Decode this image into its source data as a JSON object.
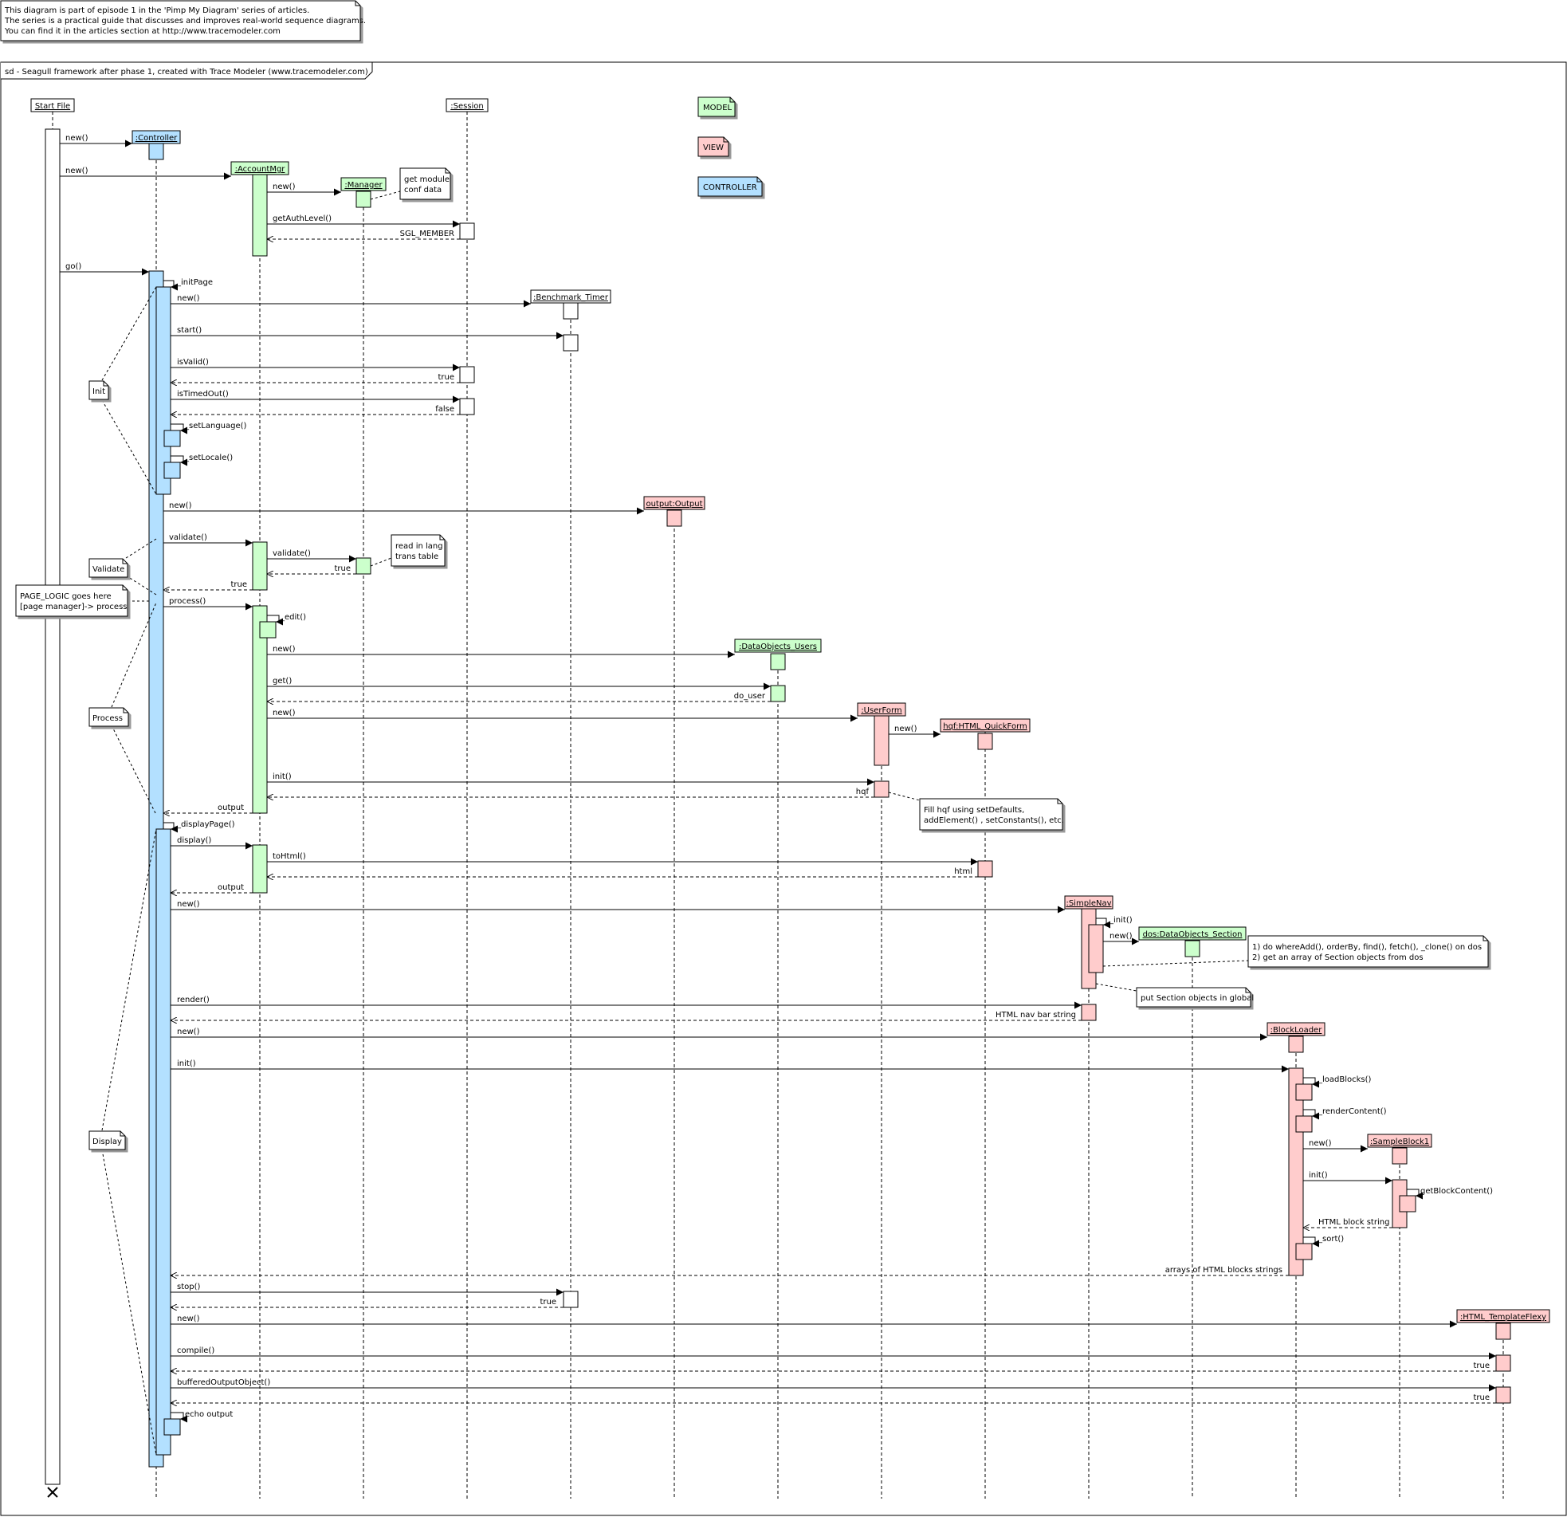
{
  "header_note": {
    "lines": [
      "This diagram is part of episode 1 in the 'Pimp My Diagram' series of articles.",
      "The series is a practical guide that discusses and improves real-world sequence diagrams.",
      "You can find it in the articles section at http://www.tracemodeler.com"
    ]
  },
  "frame": {
    "title": "sd - Seagull framework after phase 1, created with Trace Modeler (www.tracemodeler.com)"
  },
  "colors": {
    "model": "#ccffcc",
    "view": "#ffcccc",
    "controller": "#b3e0ff",
    "plain": "#ffffff",
    "line": "#000000"
  },
  "legend": {
    "model": "MODEL",
    "view": "VIEW",
    "controller": "CONTROLLER"
  },
  "lifelines": [
    {
      "id": "start",
      "label": "Start File",
      "kind": "plain"
    },
    {
      "id": "controller",
      "label": ":Controller",
      "kind": "controller"
    },
    {
      "id": "accountmgr",
      "label": ":AccountMgr",
      "kind": "model"
    },
    {
      "id": "manager",
      "label": ":Manager",
      "kind": "model"
    },
    {
      "id": "session",
      "label": ":Session",
      "kind": "plain"
    },
    {
      "id": "timer",
      "label": ":Benchmark_Timer",
      "kind": "plain"
    },
    {
      "id": "output",
      "label": "output:Output",
      "kind": "view"
    },
    {
      "id": "dousers",
      "label": ":DataObjects_Users",
      "kind": "model"
    },
    {
      "id": "userform",
      "label": ":UserForm",
      "kind": "view"
    },
    {
      "id": "hqf",
      "label": "hqf:HTML_QuickForm",
      "kind": "view"
    },
    {
      "id": "simplenav",
      "label": ":SimpleNav",
      "kind": "view"
    },
    {
      "id": "dos",
      "label": "dos:DataObjects_Section",
      "kind": "model"
    },
    {
      "id": "blockloader",
      "label": ":BlockLoader",
      "kind": "view"
    },
    {
      "id": "sampleblock",
      "label": ":SampleBlock1",
      "kind": "view"
    },
    {
      "id": "template",
      "label": ":HTML_TemplateFlexy",
      "kind": "view"
    }
  ],
  "messages": [
    {
      "label": "new()",
      "type": "create"
    },
    {
      "label": "new()",
      "type": "create"
    },
    {
      "label": "new()",
      "type": "create"
    },
    {
      "label": "getAuthLevel()",
      "type": "call"
    },
    {
      "label": "SGL_MEMBER",
      "type": "return"
    },
    {
      "label": "go()",
      "type": "call"
    },
    {
      "label": "_initPage",
      "type": "self"
    },
    {
      "label": "new()",
      "type": "create"
    },
    {
      "label": "start()",
      "type": "call"
    },
    {
      "label": "isValid()",
      "type": "call"
    },
    {
      "label": "true",
      "type": "return"
    },
    {
      "label": "isTimedOut()",
      "type": "call"
    },
    {
      "label": "false",
      "type": "return"
    },
    {
      "label": "_setLanguage()",
      "type": "self"
    },
    {
      "label": "_setLocale()",
      "type": "self"
    },
    {
      "label": "new()",
      "type": "create"
    },
    {
      "label": "validate()",
      "type": "call"
    },
    {
      "label": "validate()",
      "type": "call"
    },
    {
      "label": "true",
      "type": "return"
    },
    {
      "label": "true",
      "type": "return"
    },
    {
      "label": "process()",
      "type": "call"
    },
    {
      "label": "_edit()",
      "type": "self"
    },
    {
      "label": "new()",
      "type": "create"
    },
    {
      "label": "get()",
      "type": "call"
    },
    {
      "label": "do_user",
      "type": "return"
    },
    {
      "label": "new()",
      "type": "create"
    },
    {
      "label": "new()",
      "type": "create"
    },
    {
      "label": "init()",
      "type": "call"
    },
    {
      "label": "hqf",
      "type": "return"
    },
    {
      "label": "output",
      "type": "return"
    },
    {
      "label": "_displayPage()",
      "type": "self"
    },
    {
      "label": "display()",
      "type": "call"
    },
    {
      "label": "toHtml()",
      "type": "call"
    },
    {
      "label": "html",
      "type": "return"
    },
    {
      "label": "output",
      "type": "return"
    },
    {
      "label": "new()",
      "type": "create"
    },
    {
      "label": "_init()",
      "type": "self"
    },
    {
      "label": "new()",
      "type": "create"
    },
    {
      "label": "render()",
      "type": "call"
    },
    {
      "label": "HTML nav bar string",
      "type": "return"
    },
    {
      "label": "new()",
      "type": "create"
    },
    {
      "label": "init()",
      "type": "call"
    },
    {
      "label": "_loadBlocks()",
      "type": "self"
    },
    {
      "label": "_renderContent()",
      "type": "self"
    },
    {
      "label": "new()",
      "type": "create"
    },
    {
      "label": "init()",
      "type": "call"
    },
    {
      "label": "getBlockContent()",
      "type": "self"
    },
    {
      "label": "HTML block string",
      "type": "return"
    },
    {
      "label": "_sort()",
      "type": "self"
    },
    {
      "label": "arrays of HTML blocks strings",
      "type": "return"
    },
    {
      "label": "stop()",
      "type": "call"
    },
    {
      "label": "true",
      "type": "return"
    },
    {
      "label": "new()",
      "type": "create"
    },
    {
      "label": "compile()",
      "type": "call"
    },
    {
      "label": "true",
      "type": "return"
    },
    {
      "label": "bufferedOutputObject()",
      "type": "call"
    },
    {
      "label": "true",
      "type": "return"
    },
    {
      "label": "echo output",
      "type": "self"
    }
  ],
  "notes": [
    {
      "id": "get-module",
      "lines": [
        "get module",
        "conf data"
      ]
    },
    {
      "id": "read-lang",
      "lines": [
        "read in lang",
        "trans table"
      ]
    },
    {
      "id": "fill-hqf",
      "lines": [
        "Fill hqf using setDefaults,",
        "addElement() , setConstants(), etc."
      ]
    },
    {
      "id": "dos-ops",
      "lines": [
        "1) do whereAdd(), orderBy, find(), fetch(), _clone()  on dos",
        "2) get an array of Section objects from dos"
      ]
    },
    {
      "id": "put-section",
      "lines": [
        "put Section objects in global"
      ]
    },
    {
      "id": "page-logic",
      "lines": [
        "PAGE_LOGIC goes here",
        "[page manager]-> process"
      ]
    }
  ],
  "phases": [
    "Init",
    "Validate",
    "Process",
    "Display"
  ]
}
